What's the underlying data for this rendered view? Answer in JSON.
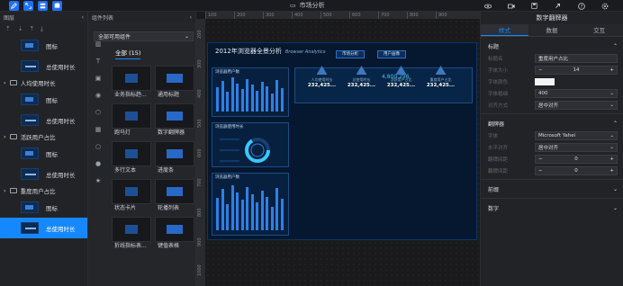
{
  "top": {
    "title": "市场分析"
  },
  "layers": {
    "title": "图层",
    "rows": [
      {
        "type": "item",
        "label": "图标",
        "thumb": "img"
      },
      {
        "type": "item",
        "label": "总使用时长",
        "thumb": "num"
      },
      {
        "type": "group",
        "label": "人均使用时长"
      },
      {
        "type": "item",
        "label": "图标",
        "thumb": "img"
      },
      {
        "type": "item",
        "label": "总使用时长",
        "thumb": "num"
      },
      {
        "type": "group",
        "label": "活跃用户占比"
      },
      {
        "type": "item",
        "label": "图标",
        "thumb": "img"
      },
      {
        "type": "item",
        "label": "总使用时长",
        "thumb": "num"
      },
      {
        "type": "group",
        "label": "重度用户占比"
      },
      {
        "type": "item",
        "label": "图标",
        "thumb": "img"
      },
      {
        "type": "item",
        "label": "总使用时长",
        "thumb": "num",
        "selected": true
      }
    ]
  },
  "components": {
    "title": "组件列表",
    "select": "全部可用组件",
    "tab": "全部 (15)",
    "cards": [
      "业务指标趋...",
      "通用标题",
      "跑马灯",
      "数字翻牌器",
      "多行文本",
      "进度条",
      "状态卡片",
      "轮播列表",
      "折线指标表...",
      "键值表格"
    ]
  },
  "canvas": {
    "ruler_top": [
      "100",
      "200",
      "300",
      "400",
      "500",
      "600",
      "700",
      "800",
      "900"
    ],
    "ruler_left": [
      "200",
      "300",
      "400",
      "500",
      "600",
      "700",
      "800",
      "900",
      "1000"
    ],
    "dash_title": "2012年浏览器全景分析",
    "dash_sub": "Browser Analytics",
    "btn1": "市场分析",
    "btn2": "用户画像",
    "panel1": "浏览器用户数",
    "panel2": "浏览器使用时长",
    "panel3": "浏览器用户数",
    "big_value": "4,800,296",
    "stats": [
      {
        "label": "人均使用时长",
        "value": "232,425..."
      },
      {
        "label": "总使用时长",
        "value": "232,425..."
      },
      {
        "label": "活跃用户占比",
        "value": "232,425..."
      },
      {
        "label": "重度用户占比",
        "value": "232,425..."
      }
    ]
  },
  "right": {
    "title": "数字翻牌器",
    "tabs": [
      "样式",
      "数据",
      "交互"
    ],
    "sec_title": "标题",
    "title_name_label": "标题名",
    "title_name_value": "重度用户占比",
    "font_size_label": "字体大小",
    "font_size": "14",
    "font_color_label": "字体颜色",
    "font_weight_label": "字体粗细",
    "font_weight": "400",
    "align_label": "对齐方式",
    "align": "居中对齐",
    "sec_flip": "翻牌器",
    "font_label": "字体",
    "font_value": "Microsoft Yahei",
    "halign_label": "水平对齐",
    "halign": "居中对齐",
    "gap_label": "翻牌间距",
    "gap": "0",
    "margin_label": "翻牌间距",
    "margin": "0",
    "sec_prefix": "前缀",
    "sec_number": "数字"
  }
}
